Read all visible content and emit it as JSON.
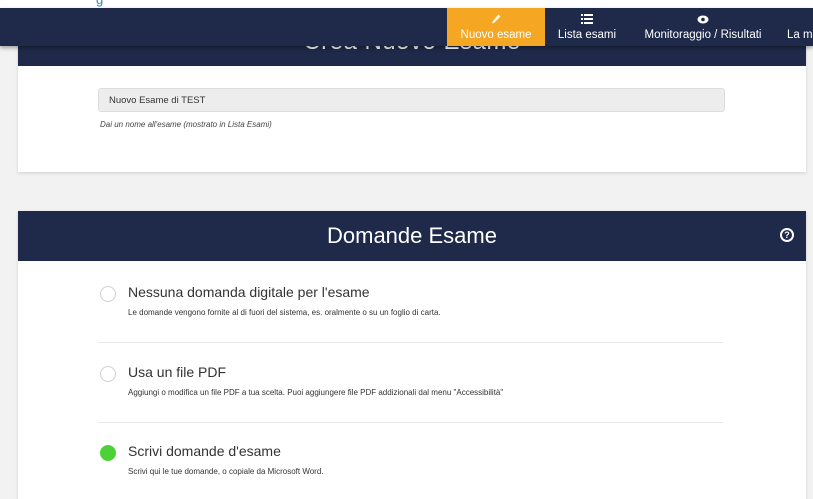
{
  "nav": {
    "items": [
      {
        "label": "Nuovo esame",
        "icon": "pencil-icon",
        "active": true
      },
      {
        "label": "Lista esami",
        "icon": "list-icon",
        "active": false
      },
      {
        "label": "Monitoraggio / Risultati",
        "icon": "eye-icon",
        "active": false
      },
      {
        "label": "La m",
        "icon": "",
        "active": false
      }
    ]
  },
  "create_exam": {
    "title": "Crea Nuovo Esame",
    "name_value": "Nuovo Esame di TEST",
    "name_hint": "Dai un nome all'esame (mostrato in Lista Esami)"
  },
  "questions": {
    "title": "Domande Esame",
    "options": [
      {
        "label": "Nessuna domanda digitale per l'esame",
        "description": "Le domande vengono fornite al di fuori del sistema, es. oralmente o su un foglio di carta.",
        "selected": false
      },
      {
        "label": "Usa un file PDF",
        "description": "Aggiungi o modifica un file PDF a tua scelta. Puoi aggiungere file PDF addizionali dal menu \"Accessibilità\"",
        "selected": false
      },
      {
        "label": "Scrivi domande d'esame",
        "description": "Scrivi qui le tue domande, o copiale da Microsoft Word.",
        "selected": true
      }
    ]
  },
  "colors": {
    "nav_bg": "#1f2a4a",
    "active_tab": "#f5a623",
    "selected_radio": "#4cd137"
  }
}
